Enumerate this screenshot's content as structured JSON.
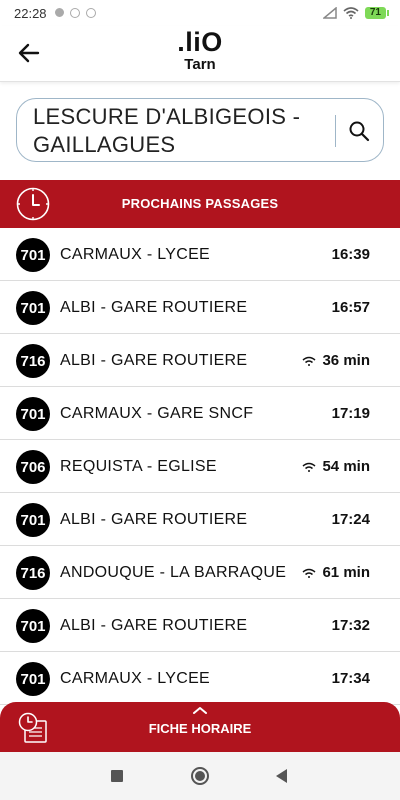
{
  "status_bar": {
    "time": "22:28",
    "battery": "71"
  },
  "app_bar": {
    "logo_main": ".liO",
    "logo_sub": "Tarn"
  },
  "stop": {
    "name": "LESCURE D'ALBIGEOIS - GAILLAGUES"
  },
  "departures_header": {
    "title": "PROCHAINS PASSAGES"
  },
  "departures": [
    {
      "line": "701",
      "destination": "CARMAUX - LYCEE",
      "time": "16:39",
      "realtime": false
    },
    {
      "line": "701",
      "destination": "ALBI - GARE ROUTIERE",
      "time": "16:57",
      "realtime": false
    },
    {
      "line": "716",
      "destination": "ALBI - GARE ROUTIERE",
      "time": "36 min",
      "realtime": true
    },
    {
      "line": "701",
      "destination": "CARMAUX - GARE SNCF",
      "time": "17:19",
      "realtime": false
    },
    {
      "line": "706",
      "destination": "REQUISTA - EGLISE",
      "time": "54 min",
      "realtime": true
    },
    {
      "line": "701",
      "destination": "ALBI - GARE ROUTIERE",
      "time": "17:24",
      "realtime": false
    },
    {
      "line": "716",
      "destination": "ANDOUQUE - LA BARRAQUE",
      "time": "61 min",
      "realtime": true
    },
    {
      "line": "701",
      "destination": "ALBI - GARE ROUTIERE",
      "time": "17:32",
      "realtime": false
    },
    {
      "line": "701",
      "destination": "CARMAUX - LYCEE",
      "time": "17:34",
      "realtime": false
    }
  ],
  "fiche": {
    "title": "FICHE HORAIRE"
  },
  "icons": {
    "back": "arrow-left-icon",
    "search": "search-icon",
    "clock": "clock-icon",
    "realtime": "wifi-signal-icon",
    "schedule": "timetable-icon"
  },
  "colors": {
    "brand_red": "#b0141e",
    "badge_black": "#000000",
    "search_border": "#9fb6c8"
  }
}
